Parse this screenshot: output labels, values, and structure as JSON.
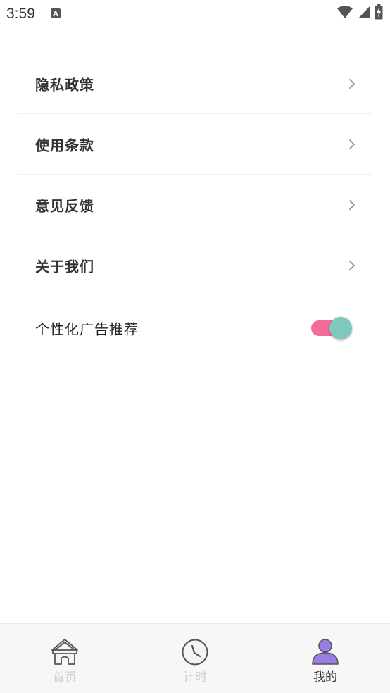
{
  "status_bar": {
    "time": "3:59",
    "notification_icon": "a-notification-icon",
    "icons": [
      "wifi-icon",
      "cell-signal-icon",
      "battery-charging-icon"
    ]
  },
  "settings": {
    "items": [
      {
        "label": "隐私政策",
        "icon": "chevron-right-icon"
      },
      {
        "label": "使用条款",
        "icon": "chevron-right-icon"
      },
      {
        "label": "意见反馈",
        "icon": "chevron-right-icon"
      },
      {
        "label": "关于我们",
        "icon": "chevron-right-icon"
      }
    ],
    "personalized_ads": {
      "label": "个性化广告推荐",
      "enabled": true
    }
  },
  "tabbar": {
    "tabs": [
      {
        "label": "首页",
        "icon": "home-icon",
        "active": false
      },
      {
        "label": "计时",
        "icon": "clock-icon",
        "active": false
      },
      {
        "label": "我的",
        "icon": "user-icon",
        "active": true
      }
    ]
  },
  "colors": {
    "toggle_track": "#f26b9a",
    "toggle_knob": "#7ec8c0",
    "tab_active_icon": "#9b7be6",
    "tab_inactive_label": "#cfcfcf",
    "tab_active_label": "#333333"
  }
}
